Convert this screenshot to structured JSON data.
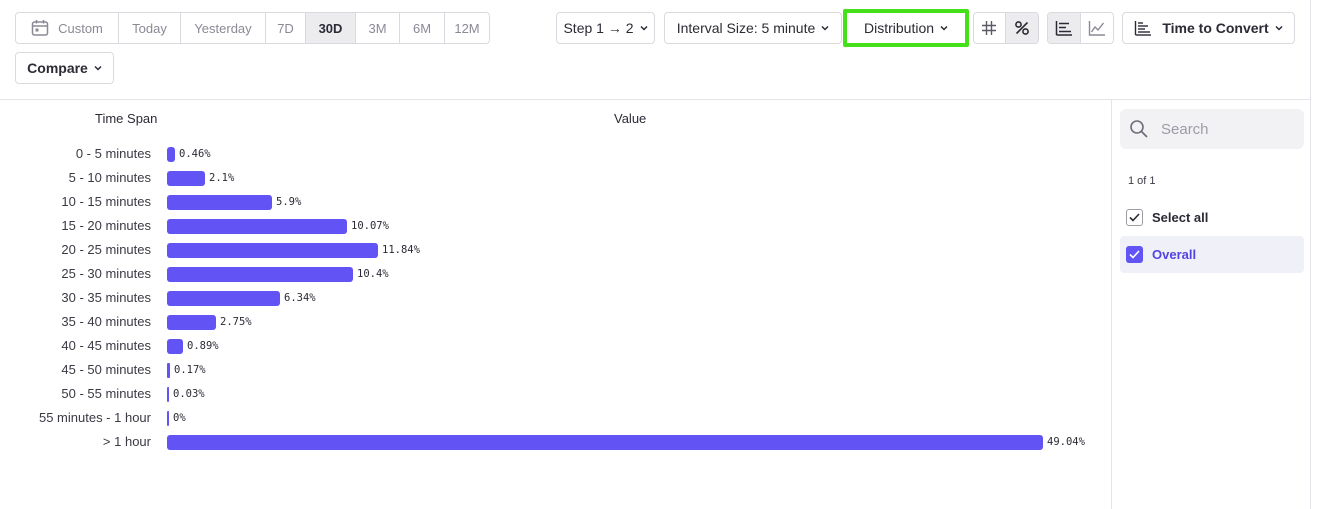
{
  "date_range": {
    "calendar_icon": "calendar-icon",
    "options": [
      "Custom",
      "Today",
      "Yesterday",
      "7D",
      "30D",
      "3M",
      "6M",
      "12M"
    ],
    "selected": "30D"
  },
  "compare": {
    "label": "Compare"
  },
  "step": {
    "label": "Step 1 → 2"
  },
  "interval": {
    "label": "Interval Size: 5 minute"
  },
  "display_mode": {
    "label": "Distribution"
  },
  "value_format": {
    "options": [
      "hash-icon",
      "percent-icon"
    ],
    "selected": "percent-icon"
  },
  "chart_type": {
    "options": [
      "bar-chart-icon",
      "line-chart-icon"
    ],
    "selected": "bar-chart-icon"
  },
  "metric": {
    "label": "Time to Convert",
    "icon": "sort-bars-icon"
  },
  "table": {
    "col_time_span": "Time Span",
    "col_value": "Value"
  },
  "chart_data": {
    "type": "bar",
    "orientation": "horizontal",
    "categories": [
      "0 - 5 minutes",
      "5 - 10 minutes",
      "10 - 15 minutes",
      "15 - 20 minutes",
      "20 - 25 minutes",
      "25 - 30 minutes",
      "30 - 35 minutes",
      "35 - 40 minutes",
      "40 - 45 minutes",
      "45 - 50 minutes",
      "50 - 55 minutes",
      "55 minutes - 1 hour",
      "> 1 hour"
    ],
    "values": [
      0.46,
      2.1,
      5.9,
      10.07,
      11.84,
      10.4,
      6.34,
      2.75,
      0.89,
      0.17,
      0.03,
      0,
      49.04
    ],
    "value_labels": [
      "0.46%",
      "2.1%",
      "5.9%",
      "10.07%",
      "11.84%",
      "10.4%",
      "6.34%",
      "2.75%",
      "0.89%",
      "0.17%",
      "0.03%",
      "0%",
      "49.04%"
    ],
    "bar_color": "#6153f4"
  },
  "sidebar": {
    "search_placeholder": "Search",
    "search_value": "",
    "pager": "1 of 1",
    "select_all": "Select all",
    "items": [
      {
        "label": "Overall",
        "checked": true
      }
    ]
  },
  "colors": {
    "accent": "#6153f4",
    "highlight": "#44e01a"
  }
}
